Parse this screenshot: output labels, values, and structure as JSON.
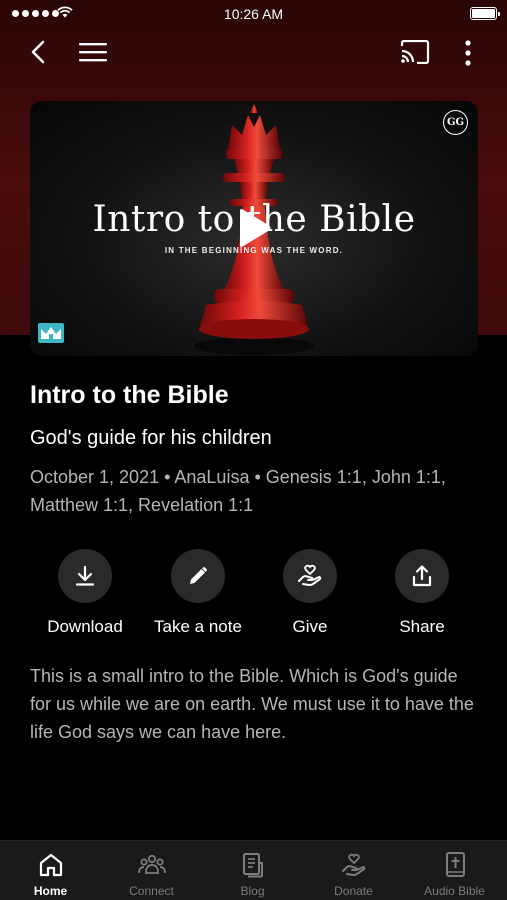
{
  "status_bar": {
    "time": "10:26 AM"
  },
  "video": {
    "overlay_title": "Intro to the Bible",
    "overlay_subtitle": "IN THE BEGINNING WAS THE WORD.",
    "corner_logo": "GG"
  },
  "content": {
    "title": "Intro to the Bible",
    "subtitle": "God's guide for his children",
    "meta": "October 1, 2021 • AnaLuisa • Genesis 1:1, John 1:1, Matthew 1:1, Revelation 1:1",
    "description": "This is a small intro to the Bible. Which is God's guide for us while we are on earth. We must use it to have the life God says we can have here."
  },
  "actions": [
    {
      "label": "Download",
      "icon": "download-icon"
    },
    {
      "label": "Take a note",
      "icon": "pencil-icon"
    },
    {
      "label": "Give",
      "icon": "give-icon"
    },
    {
      "label": "Share",
      "icon": "share-icon"
    }
  ],
  "tabs": [
    {
      "label": "Home",
      "icon": "home-icon",
      "active": true
    },
    {
      "label": "Connect",
      "icon": "people-icon",
      "active": false
    },
    {
      "label": "Blog",
      "icon": "blog-icon",
      "active": false
    },
    {
      "label": "Donate",
      "icon": "donate-icon",
      "active": false
    },
    {
      "label": "Audio Bible",
      "icon": "bible-icon",
      "active": false
    }
  ],
  "colors": {
    "hero_background": "#4a0c0c",
    "background": "#000000",
    "secondary_text": "#b5b5b5",
    "tabbar": "#1a1a1a",
    "chess_piece": "#c41818"
  }
}
